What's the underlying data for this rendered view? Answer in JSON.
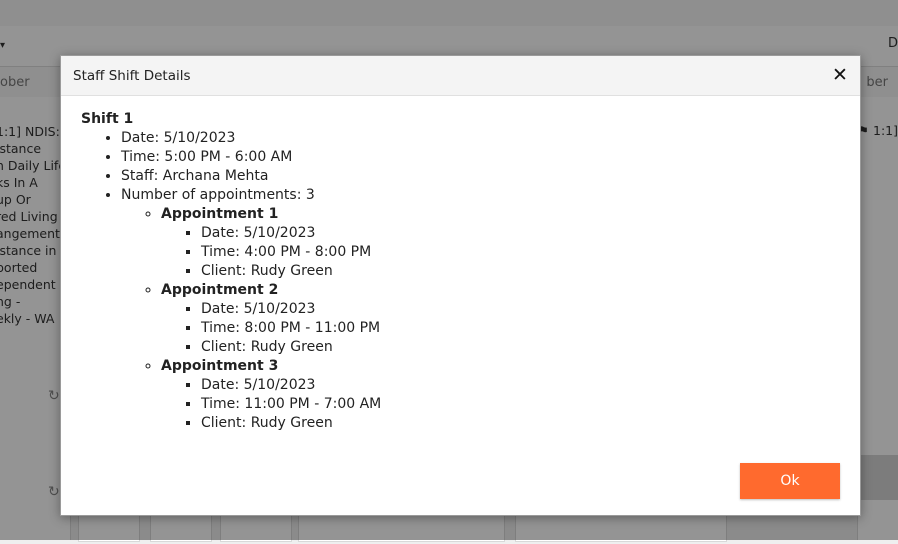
{
  "background": {
    "header_left": "ober",
    "header_right": "ber",
    "right_letter": "D",
    "left_event_lines": [
      "1:1] NDIS:",
      "istance",
      "h Daily Life",
      "ks In A",
      "up Or",
      "red Living",
      "angement:",
      "istance in",
      "ported",
      "ependent",
      "ng -",
      "ekly - WA"
    ],
    "right_event_text": "1:1]"
  },
  "modal": {
    "title": "Staff Shift Details",
    "shift": {
      "title": "Shift 1",
      "details": [
        "Date: 5/10/2023",
        "Time: 5:00 PM - 6:00 AM",
        "Staff: Archana Mehta",
        "Number of appointments: 3"
      ],
      "appointments": [
        {
          "title": "Appointment 1",
          "details": [
            "Date: 5/10/2023",
            "Time: 4:00 PM - 8:00 PM",
            "Client: Rudy Green"
          ]
        },
        {
          "title": "Appointment 2",
          "details": [
            "Date: 5/10/2023",
            "Time: 8:00 PM - 11:00 PM",
            "Client: Rudy Green"
          ]
        },
        {
          "title": "Appointment 3",
          "details": [
            "Date: 5/10/2023",
            "Time: 11:00 PM - 7:00 AM",
            "Client: Rudy Green"
          ]
        }
      ]
    },
    "ok_label": "Ok",
    "close_icon": "close-icon"
  },
  "colors": {
    "ok_button": "#ff6a2e",
    "overlay": "rgba(0,0,0,0.42)"
  }
}
